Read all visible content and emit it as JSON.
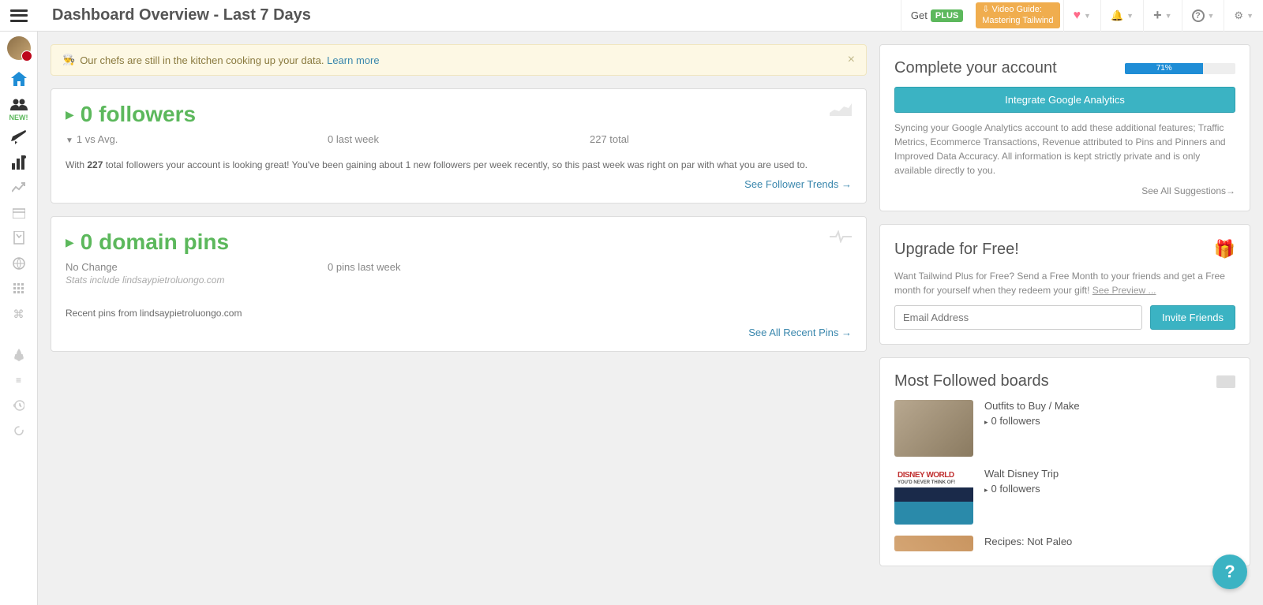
{
  "header": {
    "title": "Dashboard Overview - Last 7 Days",
    "get_label": "Get",
    "plus_badge": "PLUS",
    "video_guide_line1": "⇩ Video Guide:",
    "video_guide_line2": "Mastering Tailwind"
  },
  "sidebar": {
    "new_label": "NEW!"
  },
  "alert": {
    "text": "Our chefs are still in the kitchen cooking up your data.",
    "link": "Learn more"
  },
  "followers_panel": {
    "title": "0 followers",
    "stat1": "1 vs Avg.",
    "stat2": "0 last week",
    "stat3": "227 total",
    "desc_prefix": "With ",
    "desc_bold": "227",
    "desc_suffix": " total followers your account is looking great! You've been gaining about 1 new followers per week recently, so this past week was right on par with what you are used to.",
    "link": "See Follower Trends →"
  },
  "pins_panel": {
    "title": "0 domain pins",
    "stat1": "No Change",
    "stat2": "0 pins last week",
    "sub_note": "Stats include lindsaypietroluongo.com",
    "recent_label": "Recent pins from lindsaypietroluongo.com",
    "link": "See All Recent Pins →"
  },
  "complete_account": {
    "title": "Complete your account",
    "progress_pct": 71,
    "progress_label": "71%",
    "button": "Integrate Google Analytics",
    "text": "Syncing your Google Analytics account to add these additional features; Traffic Metrics, Ecommerce Transactions, Revenue attributed to Pins and Pinners and Improved Data Accuracy. All information is kept strictly private and is only available directly to you.",
    "see_all": "See All Suggestions→"
  },
  "upgrade": {
    "title": "Upgrade for Free!",
    "text": "Want Tailwind Plus for Free? Send a Free Month to your friends and get a Free month for yourself when they redeem your gift! ",
    "preview": "See Preview ...",
    "email_placeholder": "Email Address",
    "invite_button": "Invite Friends"
  },
  "boards": {
    "title": "Most Followed boards",
    "items": [
      {
        "name": "Outfits to Buy / Make",
        "followers": "0 followers"
      },
      {
        "name": "Walt Disney Trip",
        "followers": "0 followers"
      },
      {
        "name": "Recipes: Not Paleo",
        "followers": ""
      }
    ]
  }
}
